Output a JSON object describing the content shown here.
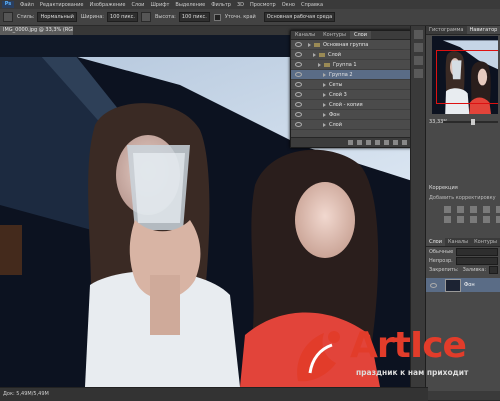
{
  "app": {
    "logo": "Ps",
    "menu": [
      "Файл",
      "Редактирование",
      "Изображение",
      "Слои",
      "Шрифт",
      "Выделение",
      "Фильтр",
      "3D",
      "Просмотр",
      "Окно",
      "Справка"
    ]
  },
  "options": {
    "style_label": "Стиль:",
    "style_value": "Нормальный",
    "width_label": "Ширина:",
    "width_value": "100 пикс.",
    "height_label": "Высота:",
    "height_value": "100 пикс.",
    "refine_label": "Уточн. край",
    "presets_value": "Основная рабочая среда"
  },
  "document": {
    "tab_title": "IMG_0000.jpg @ 33,3% (RGB/8)",
    "status": "Док: 5,49M/5,49M"
  },
  "layers_panel": {
    "tabs": [
      "Каналы",
      "Контуры",
      "Слои"
    ],
    "rows": [
      {
        "name": "Основная группа",
        "type": "folder"
      },
      {
        "name": "Слой",
        "type": "folder"
      },
      {
        "name": "Группа 1",
        "type": "folder"
      },
      {
        "name": "Группа 2",
        "type": "layer",
        "selected": true
      },
      {
        "name": "Сеты",
        "type": "layer"
      },
      {
        "name": "Слой 3",
        "type": "layer"
      },
      {
        "name": "Слой - копия",
        "type": "layer"
      },
      {
        "name": "Фон",
        "type": "layer"
      },
      {
        "name": "Слой",
        "type": "layer"
      }
    ]
  },
  "dock": {
    "tabs": [
      "Гистограмма",
      "Навигатор"
    ],
    "zoom": "33,33%",
    "adjust_title": "Коррекция",
    "adjust_sub": "Добавить корректировку",
    "layers_tabs": [
      "Слои",
      "Каналы",
      "Контуры"
    ],
    "blend_mode": "Обычные",
    "opacity_label": "Непрозр.",
    "lock_label": "Закрепить:",
    "fill_label": "Заливка:",
    "layer_name": "Фон"
  },
  "colors": {
    "accent": "#5a6c86",
    "watermark_red": "#e23c2a",
    "nav_box": "#dd1111"
  },
  "watermark": {
    "text": "ArtIce",
    "tagline": "праздник к нам приходит"
  }
}
